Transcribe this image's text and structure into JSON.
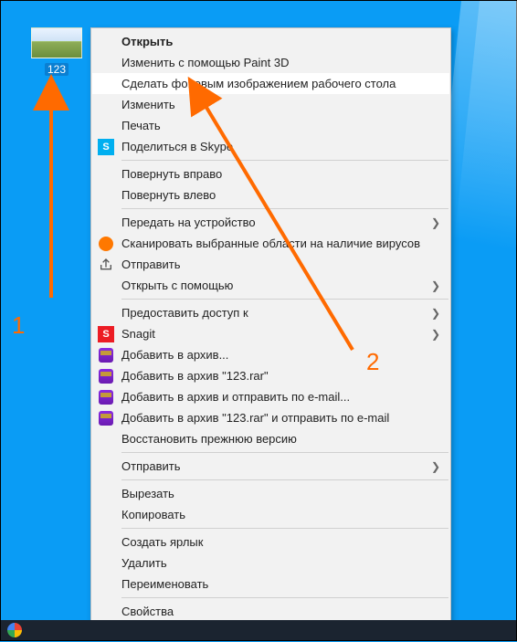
{
  "file": {
    "name": "123"
  },
  "annotations": {
    "label1": "1",
    "label2": "2"
  },
  "menu": {
    "open": "Открыть",
    "paint3d": "Изменить с помощью Paint 3D",
    "setbg": "Сделать фоновым изображением рабочего стола",
    "edit": "Изменить",
    "print": "Печать",
    "skype": "Поделиться в Skype",
    "rotr": "Повернуть вправо",
    "rotl": "Повернуть влево",
    "cast": "Передать на устройство",
    "scan": "Сканировать выбранные области на наличие вирусов",
    "send": "Отправить",
    "openwith": "Открыть с помощью",
    "giveaccess": "Предоставить доступ к",
    "snagit": "Snagit",
    "arch1": "Добавить в архив...",
    "arch2": "Добавить в архив \"123.rar\"",
    "arch3": "Добавить в архив и отправить по e-mail...",
    "arch4": "Добавить в архив \"123.rar\" и отправить по e-mail",
    "restore": "Восстановить прежнюю версию",
    "sendto": "Отправить",
    "cut": "Вырезать",
    "copy": "Копировать",
    "shortcut": "Создать ярлык",
    "delete": "Удалить",
    "rename": "Переименовать",
    "props": "Свойства"
  }
}
